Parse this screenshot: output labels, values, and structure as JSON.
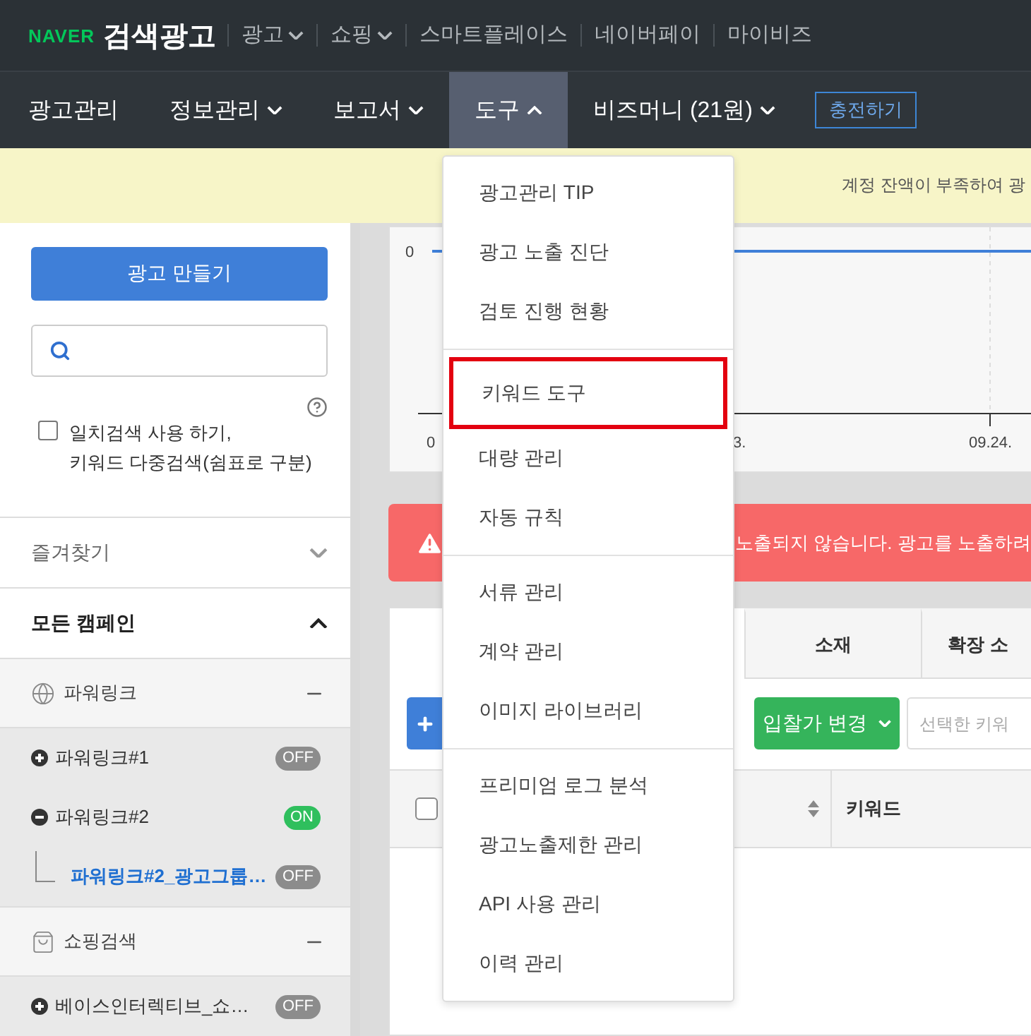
{
  "header": {
    "brand": "NAVER",
    "title": "검색광고",
    "links": [
      {
        "label": "광고",
        "dropdown": true
      },
      {
        "label": "쇼핑",
        "dropdown": true
      },
      {
        "label": "스마트플레이스",
        "dropdown": false
      },
      {
        "label": "네이버페이",
        "dropdown": false
      },
      {
        "label": "마이비즈",
        "dropdown": false
      }
    ]
  },
  "nav": {
    "items": [
      {
        "label": "광고관리",
        "kind": "link",
        "selected": false
      },
      {
        "label": "정보관리",
        "kind": "dropdown",
        "selected": false,
        "expanded": false
      },
      {
        "label": "보고서",
        "kind": "dropdown",
        "selected": false,
        "expanded": false
      },
      {
        "label": "도구",
        "kind": "dropdown",
        "selected": true,
        "expanded": true
      },
      {
        "label": "비즈머니 (21원)",
        "kind": "dropdown",
        "selected": false,
        "expanded": false
      }
    ],
    "charge_button": "충전하기"
  },
  "notice": {
    "text": "계정 잔액이 부족하여 광"
  },
  "sidebar": {
    "create_button": "광고 만들기",
    "exact_match": {
      "lines": [
        "일치검색 사용 하기,",
        "키워드 다중검색(쉼표로 구분)"
      ],
      "checked": false
    },
    "sections": [
      {
        "label": "즐겨찾기",
        "expanded": false
      },
      {
        "label": "모든 캠페인",
        "expanded": true
      }
    ],
    "campaign_types": [
      {
        "kind": "powerlink",
        "label": "파워링크",
        "expanded": true,
        "campaigns": [
          {
            "name": "파워링크#1",
            "expanded": false,
            "status": "OFF",
            "on": false,
            "selected": false
          },
          {
            "name": "파워링크#2",
            "expanded": true,
            "status": "ON",
            "on": true,
            "selected": false,
            "children": [
              {
                "name": "파워링크#2_광고그룹…",
                "status": "OFF",
                "on": false,
                "selected": true
              }
            ]
          }
        ]
      },
      {
        "kind": "shopping",
        "label": "쇼핑검색",
        "expanded": true,
        "campaigns": [
          {
            "name": "베이스인터렉티브_쇼…",
            "expanded": false,
            "status": "OFF",
            "on": false,
            "selected": false
          }
        ]
      }
    ]
  },
  "main": {
    "chart": {
      "y_label": "0",
      "x_labels": [
        "0",
        "3.",
        "09.24."
      ]
    },
    "alert": {
      "text": "노출되지 않습니다. 광고를 노출하려"
    },
    "tabs": [
      {
        "label": "소재",
        "selected": false
      },
      {
        "label": "확장 소",
        "selected": false
      }
    ],
    "toolbar": {
      "bid_button": "입찰가 변경",
      "keyword_field": {
        "placeholder": "선택한 키워"
      }
    },
    "table": {
      "select_all_checked": false,
      "columns": [
        {
          "label": "키워드"
        }
      ]
    }
  },
  "tools_menu": {
    "groups": [
      [
        {
          "label": "광고관리 TIP",
          "highlighted": false
        },
        {
          "label": "광고 노출 진단",
          "highlighted": false
        },
        {
          "label": "검토 진행 현황",
          "highlighted": false
        }
      ],
      [
        {
          "label": "키워드 도구",
          "highlighted": true
        },
        {
          "label": "대량 관리",
          "highlighted": false
        },
        {
          "label": "자동 규칙",
          "highlighted": false
        }
      ],
      [
        {
          "label": "서류 관리",
          "highlighted": false
        },
        {
          "label": "계약 관리",
          "highlighted": false
        },
        {
          "label": "이미지 라이브러리",
          "highlighted": false
        }
      ],
      [
        {
          "label": "프리미엄 로그 분석",
          "highlighted": false
        },
        {
          "label": "광고노출제한 관리",
          "highlighted": false
        },
        {
          "label": "API 사용 관리",
          "highlighted": false
        },
        {
          "label": "이력 관리",
          "highlighted": false
        }
      ]
    ]
  }
}
